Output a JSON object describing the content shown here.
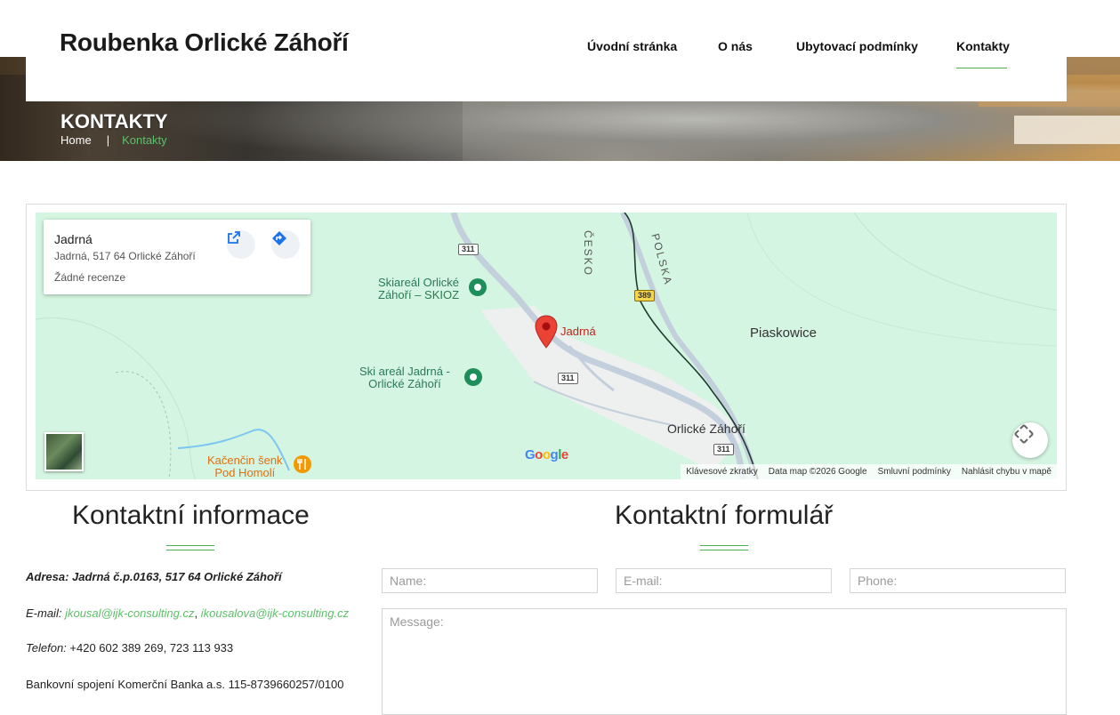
{
  "site": {
    "title": "Roubenka Orlické Záhoří"
  },
  "nav": [
    {
      "label": "Úvodní stránka"
    },
    {
      "label": "O nás"
    },
    {
      "label": "Ubytovací podmínky"
    },
    {
      "label": "Kontakty",
      "active": true
    }
  ],
  "hero": {
    "heading": "KONTAKTY",
    "breadcrumb": {
      "home": "Home",
      "separator": "|",
      "current": "Kontakty"
    }
  },
  "map": {
    "card": {
      "title": "Jadrná",
      "address": "Jadrná, 517 64 Orlické Záhoří",
      "reviews": "Žádné recenze"
    },
    "labels": {
      "skiareal_1": "Skiareál Orlické",
      "skiareal_2": "Záhoří – SKIOZ",
      "jadrna_pin": "Jadrná",
      "skiareal_jadrna_1": "Ski areál Jadrná -",
      "skiareal_jadrna_2": "Orlické Záhoří",
      "piaskowice": "Piaskowice",
      "orlicke_zahori": "Orlické Záhoří",
      "kacencin_1": "Kačenčin šenk",
      "kacencin_2": "Pod Homolí",
      "border_cz": "ČESKO",
      "border_pl": "POLSKA"
    },
    "roads": {
      "r311a": "311",
      "r311b": "311",
      "r311c": "311",
      "r389": "389"
    },
    "attribution": {
      "shortcuts": "Klávesové zkratky",
      "data": "Data map ©2026 Google",
      "terms": "Smluvní podmínky",
      "report": "Nahlásit chybu v mapě"
    },
    "colors": {
      "land": "#d4f5e1",
      "road": "#c3cfdc",
      "pin": "#ea4335"
    }
  },
  "contact_info": {
    "title": "Kontaktní informace",
    "address": "Adresa: Jadrná č.p.0163, 517 64 Orlické Záhoří",
    "email_label": "E-mail:",
    "email_1": "jkousal@ijk-consulting.cz",
    "email_sep": ",",
    "email_2": "ikousalova@ijk-consulting.cz",
    "phone_label": "Telefon:",
    "phone": "+420 602 389 269, 723 113 933",
    "bank": "Bankovní spojení Komerční Banka a.s. 115-8739660257/0100"
  },
  "contact_form": {
    "title": "Kontaktní formulář",
    "name_placeholder": "Name:",
    "email_placeholder": "E-mail:",
    "phone_placeholder": "Phone:",
    "message_placeholder": "Message:"
  },
  "theme": {
    "accent": "#4caf50"
  }
}
